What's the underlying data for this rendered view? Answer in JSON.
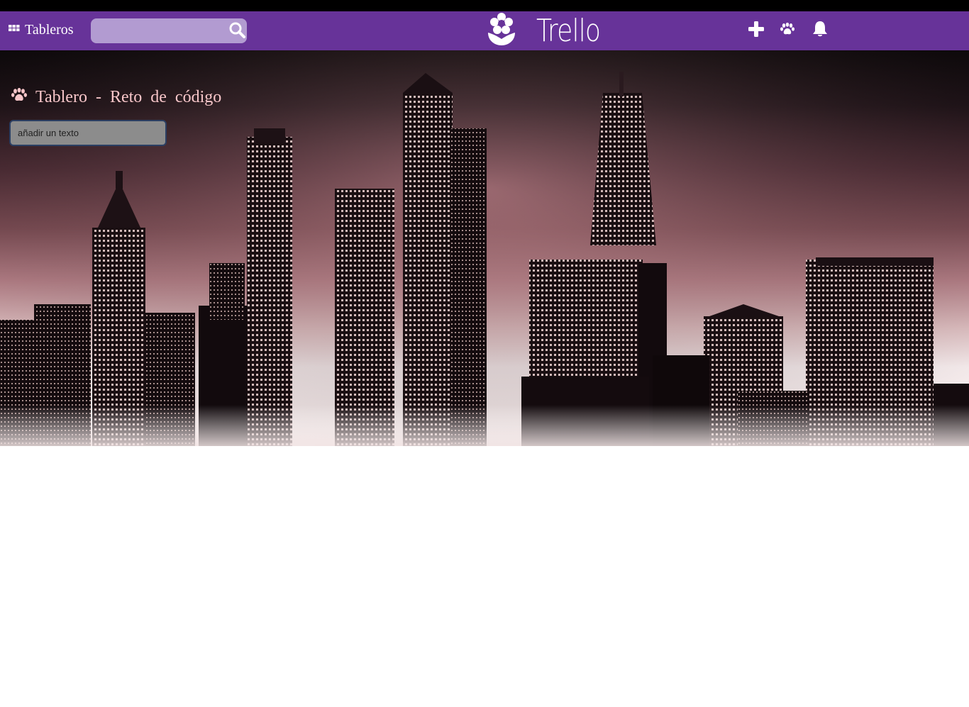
{
  "navbar": {
    "boards_label": "Tableros",
    "search_placeholder": "",
    "brand_name": "Trello",
    "color": "#673399",
    "icons": [
      "boards-icon",
      "search-icon",
      "flower-icon",
      "plus-icon",
      "paw-icon",
      "bell-icon"
    ]
  },
  "board": {
    "title": "Tablero - Reto de código",
    "title_color": "#f7c6c9",
    "add_input_value": "añadir un texto"
  }
}
